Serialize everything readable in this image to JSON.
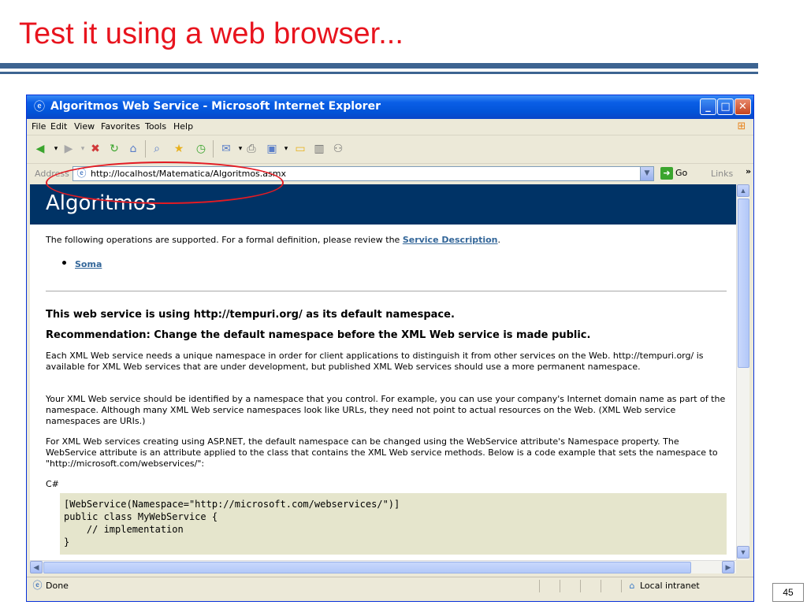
{
  "slide": {
    "title": "Test it using a web browser...",
    "page_number": "45"
  },
  "window": {
    "title": "Algoritmos Web Service - Microsoft Internet Explorer",
    "menu": [
      "File",
      "Edit",
      "View",
      "Favorites",
      "Tools",
      "Help"
    ],
    "address_label": "Address",
    "address_value": "http://localhost/Matematica/Algoritmos.asmx",
    "go_label": "Go",
    "links_label": "Links",
    "toolbar_icons": [
      "back-icon",
      "forward-icon",
      "stop-icon",
      "refresh-icon",
      "home-icon",
      "search-icon",
      "favorites-icon",
      "history-icon",
      "mail-icon",
      "print-icon",
      "edit-icon",
      "discuss-icon",
      "research-icon",
      "messenger-icon"
    ],
    "status_text": "Done",
    "zone_text": "Local intranet"
  },
  "page": {
    "heading": "Algoritmos",
    "intro_text": "The following operations are supported. For a formal definition, please review the ",
    "service_description_link": "Service Description",
    "intro_end": ".",
    "operations": [
      "Soma"
    ],
    "namespace_heading": "This web service is using http://tempuri.org/ as its default namespace.",
    "recommendation_heading": "Recommendation: Change the default namespace before the XML Web service is made public.",
    "para1": "Each XML Web service needs a unique namespace in order for client applications to distinguish it from other services on the Web. http://tempuri.org/ is available for XML Web services that are under development, but published XML Web services should use a more permanent namespace.",
    "para2": "Your XML Web service should be identified by a namespace that you control. For example, you can use your company's Internet domain name as part of the namespace. Although many XML Web service namespaces look like URLs, they need not point to actual resources on the Web. (XML Web service namespaces are URIs.)",
    "para3": "For XML Web services creating using ASP.NET, the default namespace can be changed using the WebService attribute's Namespace property. The WebService attribute is an attribute applied to the class that contains the XML Web service methods. Below is a code example that sets the namespace to \"http://microsoft.com/webservices/\":",
    "language_label": "C#",
    "code_lines": [
      "[WebService(Namespace=\"http://microsoft.com/webservices/\")]",
      "public class MyWebService {",
      "    // implementation",
      "}"
    ]
  },
  "colors": {
    "slide_title": "#e8141e",
    "rule": "#3d6491",
    "page_header": "#003366",
    "link": "#336699",
    "annotation_ellipse": "#e31b23"
  }
}
